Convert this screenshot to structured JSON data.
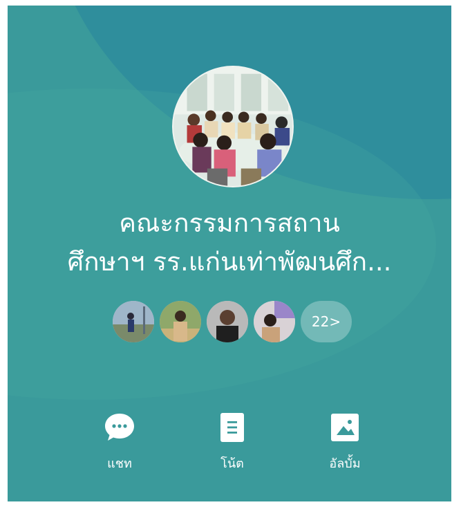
{
  "group": {
    "name_line1": "คณะกรรมการสถาน",
    "name_line2": "ศึกษาฯ รร.แก่นเท่าพัฒนศึก..."
  },
  "members": {
    "more_label": "22>"
  },
  "actions": {
    "chat_label": "แชท",
    "note_label": "โน้ต",
    "album_label": "อัลบั้ม"
  },
  "colors": {
    "background": "#3a9a9b",
    "wave": "#2f8e9c",
    "foreground": "#ffffff"
  }
}
